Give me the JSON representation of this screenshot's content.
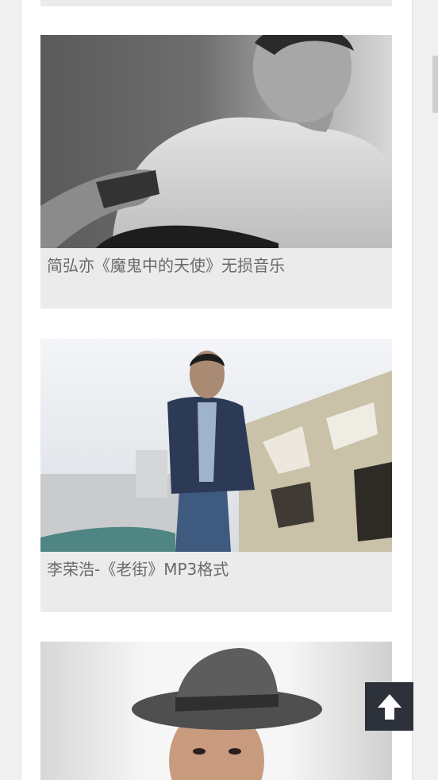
{
  "feed": {
    "items": [
      {
        "caption": "简弘亦《魔鬼中的天使》无损音乐",
        "image_description": "black-and-white portrait of a man in a t-shirt holding a guitar"
      },
      {
        "caption": "李荣浩-《老街》MP3格式",
        "image_description": "man in denim jacket standing by a weathered wall"
      },
      {
        "caption": "",
        "image_description": "man wearing a grey fedora hat"
      }
    ]
  },
  "controls": {
    "back_to_top_icon": "arrow-up-icon"
  }
}
